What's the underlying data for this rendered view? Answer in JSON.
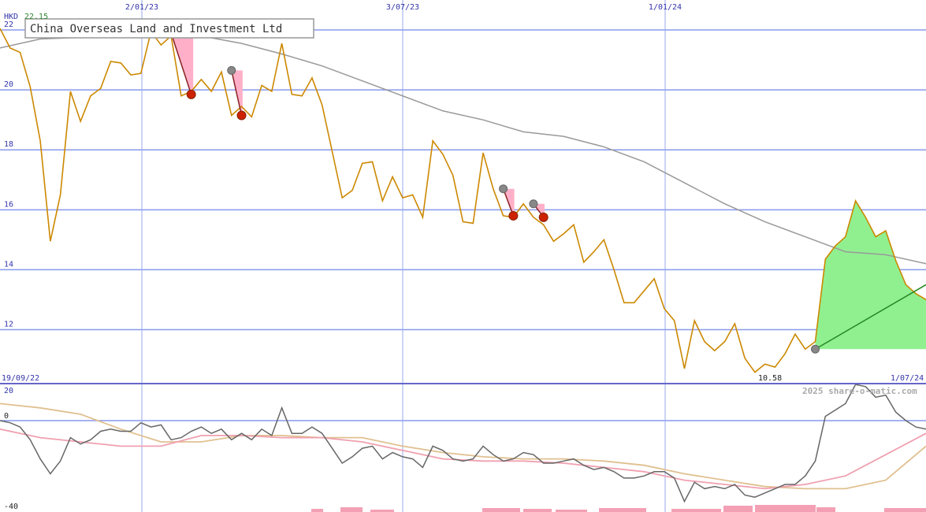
{
  "chart_data": {
    "type": "line",
    "title": "China Overseas Land and Investment Ltd",
    "currency": "HKD",
    "last_high": "22.15",
    "period_low": "10.58",
    "start_date": "19/09/22",
    "end_date": "1/07/24",
    "watermark": "2025 share-o-matic.com",
    "x_ticks": [
      {
        "label": "2/01/23",
        "pos": 15
      },
      {
        "label": "3/07/23",
        "pos": 41
      },
      {
        "label": "1/01/24",
        "pos": 67
      }
    ],
    "y_ticks": [
      12,
      14,
      16,
      18,
      20,
      22
    ],
    "ylim": [
      10.2,
      23.0
    ],
    "lower_panel": {
      "y_ticks": [
        20,
        0,
        -40
      ],
      "ylim": [
        -40,
        20
      ]
    },
    "series": [
      {
        "name": "price",
        "color": "#cc8800",
        "x": [
          0,
          1,
          2,
          3,
          4,
          5,
          6,
          7,
          8,
          9,
          10,
          11,
          12,
          13,
          14,
          15,
          16,
          17,
          18,
          19,
          20,
          21,
          22,
          23,
          24,
          25,
          26,
          27,
          28,
          29,
          30,
          31,
          32,
          33,
          34,
          35,
          36,
          37,
          38,
          39,
          40,
          41,
          42,
          43,
          44,
          45,
          46,
          47,
          48,
          49,
          50,
          51,
          52,
          53,
          54,
          55,
          56,
          57,
          58,
          59,
          60,
          61,
          62,
          63,
          64,
          65,
          66,
          67,
          68,
          69,
          70,
          71,
          72,
          73,
          74,
          75,
          76,
          77,
          78,
          79,
          80,
          81,
          82,
          83,
          84,
          85,
          86,
          87,
          88,
          89,
          90,
          91,
          92
        ],
        "values": [
          22.05,
          21.4,
          21.25,
          20.1,
          18.3,
          14.95,
          16.5,
          19.95,
          18.95,
          19.8,
          20.05,
          20.95,
          20.9,
          20.5,
          20.55,
          21.95,
          21.5,
          21.8,
          19.8,
          19.95,
          20.35,
          19.95,
          20.6,
          19.15,
          19.45,
          19.1,
          20.15,
          19.95,
          21.55,
          19.85,
          19.8,
          20.4,
          19.5,
          17.95,
          16.4,
          16.65,
          17.55,
          17.6,
          16.3,
          17.1,
          16.4,
          16.5,
          15.75,
          18.3,
          17.85,
          17.15,
          15.6,
          15.55,
          17.9,
          16.7,
          15.8,
          15.75,
          16.2,
          15.75,
          15.5,
          14.95,
          15.2,
          15.5,
          14.25,
          14.6,
          15.0,
          14.0,
          12.9,
          12.9,
          13.3,
          13.7,
          12.7,
          12.3,
          10.7,
          12.3,
          11.6,
          11.3,
          11.6,
          12.2,
          11.05,
          10.58,
          10.85,
          10.75,
          11.2,
          11.85,
          11.35,
          11.6,
          14.35,
          14.8,
          15.1,
          16.3,
          15.75,
          15.1,
          15.3,
          14.3,
          13.5,
          13.2,
          13.0
        ]
      },
      {
        "name": "moving average",
        "color": "#999999",
        "x": [
          0,
          4,
          8,
          12,
          16,
          18,
          20,
          24,
          28,
          32,
          36,
          40,
          44,
          48,
          52,
          56,
          60,
          64,
          68,
          72,
          76,
          80,
          84,
          88,
          92
        ],
        "values": [
          21.4,
          21.7,
          21.75,
          21.9,
          22.05,
          22.05,
          21.8,
          21.55,
          21.2,
          20.8,
          20.3,
          19.8,
          19.3,
          19.0,
          18.6,
          18.45,
          18.1,
          17.6,
          16.9,
          16.2,
          15.6,
          15.1,
          14.6,
          14.5,
          14.2
        ]
      }
    ],
    "signals": {
      "sell": [
        {
          "x_from": 17,
          "y_from": 21.9,
          "x_to": 19,
          "y_to": 19.85
        },
        {
          "x_from": 23,
          "y_from": 20.65,
          "x_to": 24,
          "y_to": 19.15
        },
        {
          "x_from": 50,
          "y_from": 16.7,
          "x_to": 51,
          "y_to": 15.8
        },
        {
          "x_from": 53,
          "y_from": 16.2,
          "x_to": 54,
          "y_to": 15.75
        }
      ],
      "buy": [
        {
          "x": 81,
          "y": 11.35
        }
      ]
    },
    "lower_series": [
      {
        "name": "momentum",
        "color": "#666666",
        "x": [
          0,
          1,
          2,
          3,
          4,
          5,
          6,
          7,
          8,
          9,
          10,
          11,
          12,
          13,
          14,
          15,
          16,
          17,
          18,
          19,
          20,
          21,
          22,
          23,
          24,
          25,
          26,
          27,
          28,
          29,
          30,
          31,
          32,
          33,
          34,
          35,
          36,
          37,
          38,
          39,
          40,
          41,
          42,
          43,
          44,
          45,
          46,
          47,
          48,
          49,
          50,
          51,
          52,
          53,
          54,
          55,
          56,
          57,
          58,
          59,
          60,
          61,
          62,
          63,
          64,
          65,
          66,
          67,
          68,
          69,
          70,
          71,
          72,
          73,
          74,
          75,
          76,
          77,
          78,
          79,
          80,
          81,
          82,
          83,
          84,
          85,
          86,
          87,
          88,
          89,
          90,
          91,
          92
        ],
        "values": [
          0,
          -1,
          -3,
          -9,
          -18,
          -25,
          -19,
          -8,
          -11,
          -9,
          -5,
          -4,
          -5,
          -5,
          -1,
          -3,
          -2,
          -9,
          -8,
          -5,
          -3,
          -6,
          -4,
          -9,
          -6,
          -9,
          -4,
          -7,
          6,
          -6,
          -6,
          -3,
          -6,
          -13,
          -20,
          -17,
          -13,
          -12,
          -18,
          -15,
          -17,
          -18,
          -22,
          -12,
          -14,
          -18,
          -19,
          -18,
          -12,
          -16,
          -19,
          -18,
          -15,
          -16,
          -20,
          -20,
          -19,
          -18,
          -21,
          -23,
          -22,
          -24,
          -27,
          -27,
          -26,
          -24,
          -24,
          -27,
          -38,
          -29,
          -32,
          -31,
          -32,
          -30,
          -35,
          -36,
          -34,
          -32,
          -30,
          -30,
          -26,
          -19,
          2,
          5,
          8,
          17,
          16,
          11,
          12,
          4,
          0,
          -3,
          -4
        ]
      },
      {
        "name": "signal 1",
        "color": "#f0a0b0",
        "x": [
          0,
          4,
          8,
          12,
          16,
          20,
          24,
          28,
          32,
          36,
          40,
          44,
          48,
          52,
          56,
          60,
          64,
          68,
          72,
          76,
          80,
          84,
          88,
          92
        ],
        "values": [
          -4,
          -8,
          -10,
          -12,
          -12,
          -7,
          -7,
          -8,
          -8,
          -10,
          -14,
          -18,
          -19,
          -19,
          -20,
          -22,
          -24,
          -28,
          -30,
          -32,
          -30,
          -26,
          -16,
          -6
        ]
      },
      {
        "name": "signal 2",
        "color": "#e0c090",
        "x": [
          0,
          4,
          8,
          12,
          16,
          20,
          24,
          28,
          32,
          36,
          40,
          44,
          48,
          52,
          56,
          60,
          64,
          68,
          72,
          76,
          80,
          84,
          88,
          92
        ],
        "values": [
          8,
          6,
          3,
          -4,
          -10,
          -10,
          -7,
          -7,
          -8,
          -8,
          -12,
          -15,
          -17,
          -18,
          -18,
          -19,
          -21,
          -25,
          -28,
          -31,
          -32,
          -32,
          -28,
          -12
        ]
      }
    ],
    "volume_color": "#f4a0b4"
  }
}
